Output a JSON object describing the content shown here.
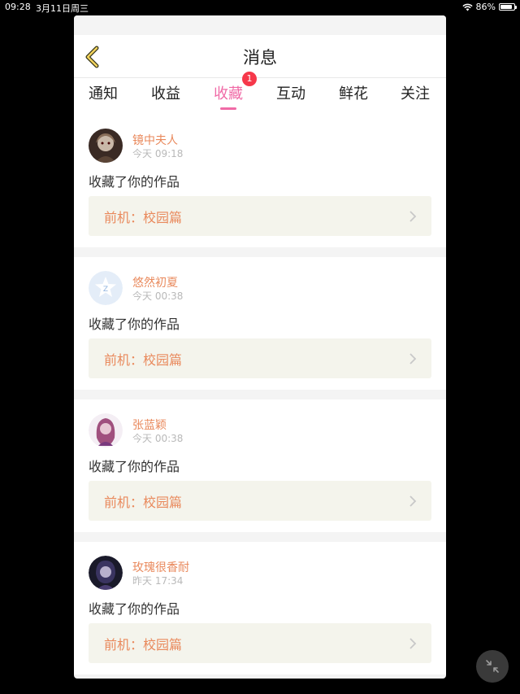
{
  "status_bar": {
    "time": "09:28",
    "date": "3月11日周三",
    "battery": "86%",
    "battery_level": 0.86
  },
  "header": {
    "title": "消息"
  },
  "tabs": [
    {
      "label": "通知"
    },
    {
      "label": "收益"
    },
    {
      "label": "收藏",
      "badge": "1",
      "active": true
    },
    {
      "label": "互动"
    },
    {
      "label": "鲜花"
    },
    {
      "label": "关注"
    }
  ],
  "items": [
    {
      "name": "镜中夫人",
      "time": "今天 09:18",
      "action": "收藏了你的作品",
      "work": "前机：校园篇",
      "avatar": "dark-portrait"
    },
    {
      "name": "悠然初夏",
      "time": "今天 00:38",
      "action": "收藏了你的作品",
      "work": "前机：校园篇",
      "avatar": "default-star"
    },
    {
      "name": "张蓝颖",
      "time": "今天 00:38",
      "action": "收藏了你的作品",
      "work": "前机：校园篇",
      "avatar": "purple-portrait"
    },
    {
      "name": "玫瑰很香耐",
      "time": "昨天 17:34",
      "action": "收藏了你的作品",
      "work": "前机：校园篇",
      "avatar": "dark-portrait-2"
    }
  ],
  "colors": {
    "accent": "#f06aa6",
    "name": "#e9895c",
    "badge": "#f6384a"
  }
}
